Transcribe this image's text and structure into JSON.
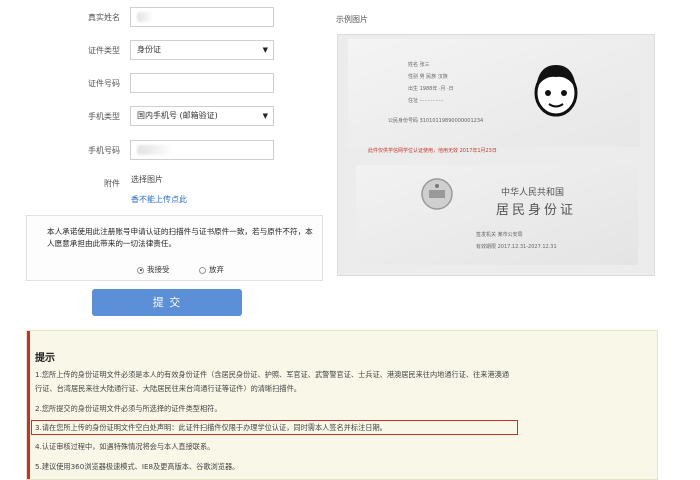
{
  "form": {
    "real_name_label": "真实姓名",
    "id_type_label": "证件类型",
    "id_type_value": "身份证",
    "id_number_label": "证件号码",
    "phone_type_label": "手机类型",
    "phone_type_value": "国内手机号 (邮箱验证)",
    "phone_number_label": "手机号码",
    "attachment_label": "附件",
    "choose_image": "选择图片",
    "upload_link": "香不能上传点此",
    "declaration": "本人承诺使用此注册账号申请认证的扫描件与证书原件一致，若与原件不符，本人愿意承担由此带来的一切法律责任。",
    "accept_label": "我接受",
    "decline_label": "放弃",
    "submit_label": "提 交"
  },
  "sample": {
    "title": "示例图片",
    "card_back_lines": [
      "姓名  张三",
      "性别  男  民族 汉族",
      "出生  1988年 ·月 ·日",
      "住址  ···············",
      "",
      "公民身份号码  31010119890000001234"
    ],
    "stamp_note": "此件仅供学信网学位认证使用，他用无效    2017年1月23日",
    "card_front_title": "中华人民共和国",
    "card_front_subtitle": "居民身份证",
    "issuer_line": "签发机关   某市公安局",
    "validity_line": "有效期限   2017.12.31-2027.12.31"
  },
  "notice": {
    "title": "提示",
    "items": [
      "1.您所上传的身份证明文件必须是本人的有效身份证件（含居民身份证、护照、军官证、武警警官证、士兵证、港澳居民来往内地通行证、往来港澳通",
      "行证、台湾居民来往大陆通行证、大陆居民往来台湾通行证等证件）的清晰扫描件。",
      "2.您所提交的身份证明文件必须与所选择的证件类型相符。",
      "3.请在您所上传的身份证明文件空白处声明：此证件扫描件仅限于办理学位认证，同时需本人签名并标注日期。",
      "4.认证审核过程中，如遇特殊情况将会与本人直接联系。",
      "5.建议使用360浏览器极速模式、IE8及更高版本、谷歌浏览器。"
    ]
  },
  "colors": {
    "submit_bg": "#5b8fd8",
    "link": "#2a6fc9",
    "notice_bg": "#f8f7e8",
    "highlight_border": "#c9302c"
  }
}
